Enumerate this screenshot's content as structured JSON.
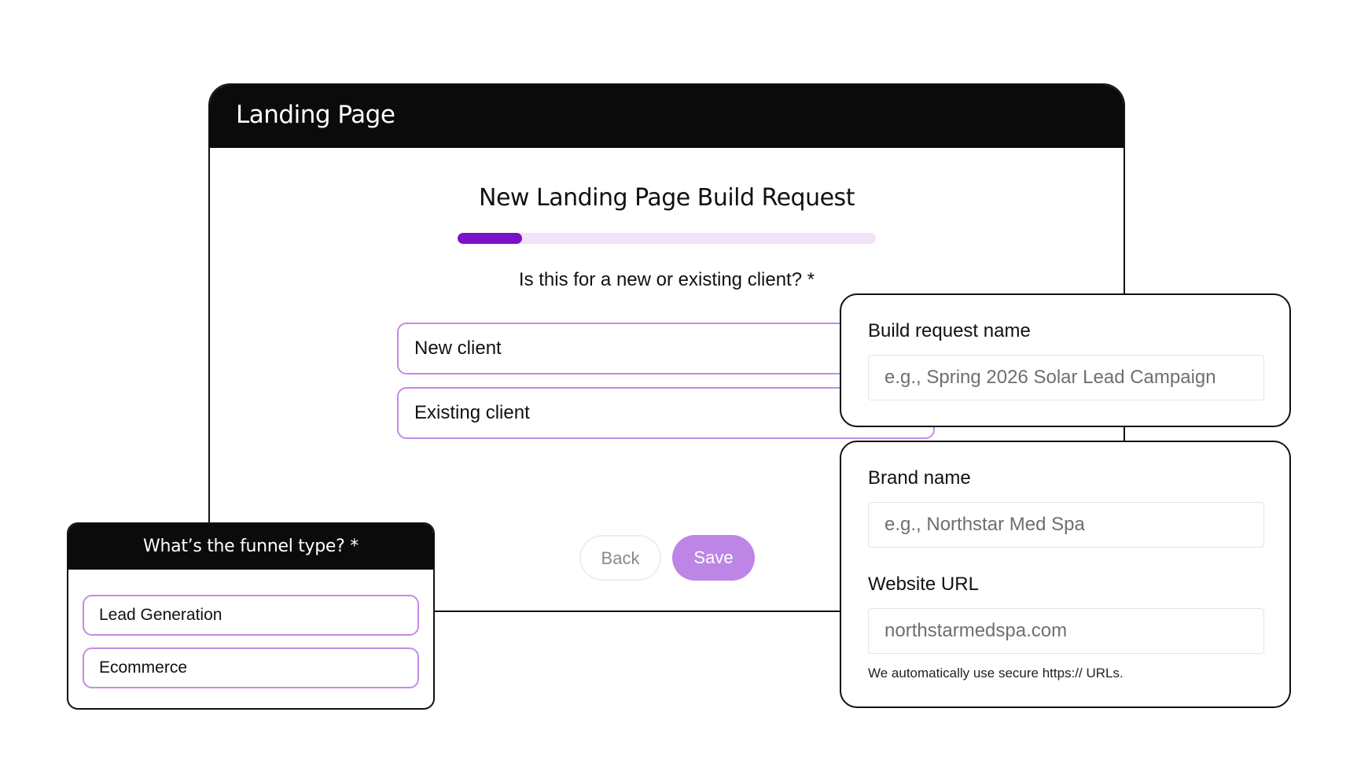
{
  "window": {
    "title": "Landing Page",
    "form_title": "New Landing Page Build Request",
    "progress": 0.155,
    "question": "Is this for a new or existing client? *",
    "options": [
      "New client",
      "Existing client"
    ],
    "back_label": "Back",
    "save_label": "Save"
  },
  "funnel": {
    "title": "What’s the funnel type? *",
    "options": [
      "Lead Generation",
      "Ecommerce"
    ]
  },
  "build_request": {
    "label": "Build request name",
    "placeholder": "e.g., Spring 2026 Solar Lead Campaign"
  },
  "brand": {
    "label": "Brand name",
    "placeholder": "e.g., Northstar Med Spa",
    "url_label": "Website URL",
    "url_placeholder": "northstarmedspa.com",
    "url_hint": "We automatically use secure https:// URLs."
  },
  "colors": {
    "accent": "#7a12c8",
    "accent_light": "#f1e3f8",
    "option_border": "#c58ae6",
    "save_button": "#bd86e6",
    "header_bg": "#0b0b0b"
  }
}
